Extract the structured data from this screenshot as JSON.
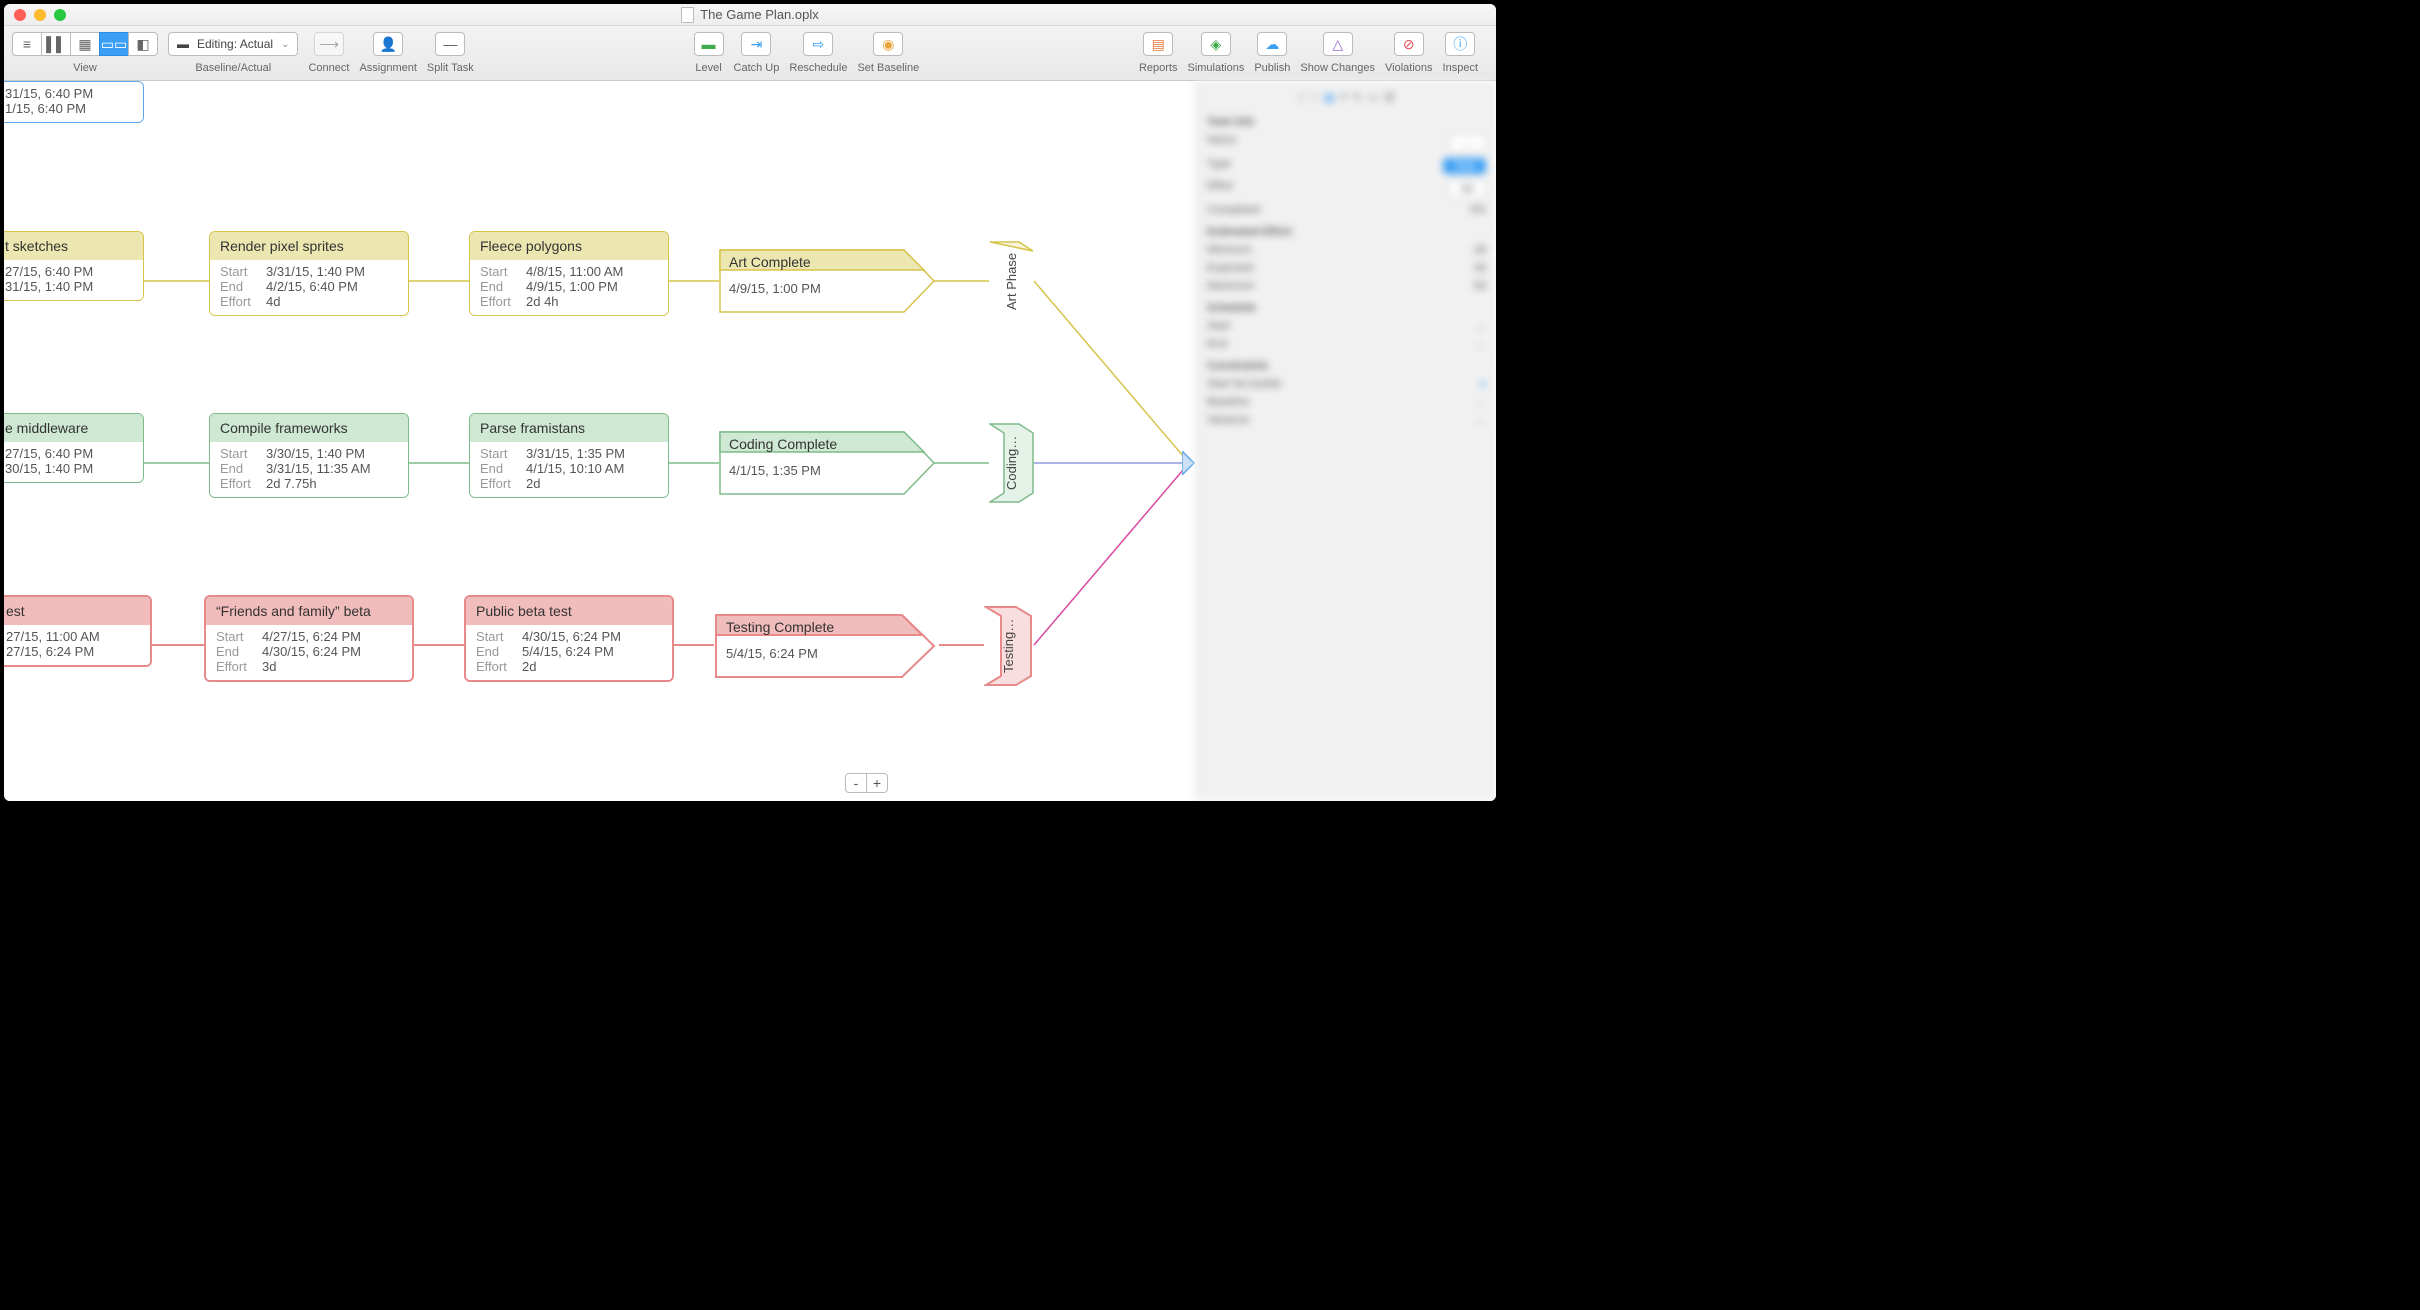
{
  "window": {
    "title": "The Game Plan.oplx"
  },
  "toolbar": {
    "view_label": "View",
    "baseline_label": "Baseline/Actual",
    "baseline_dropdown": "Editing: Actual",
    "connect": "Connect",
    "assignment": "Assignment",
    "split_task": "Split Task",
    "level": "Level",
    "catch_up": "Catch Up",
    "reschedule": "Reschedule",
    "set_baseline": "Set Baseline",
    "reports": "Reports",
    "simulations": "Simulations",
    "publish": "Publish",
    "show_changes": "Show Changes",
    "violations": "Violations",
    "inspect": "Inspect"
  },
  "partial_top": {
    "line1": "31/15, 6:40 PM",
    "line2": "1/15, 6:40 PM"
  },
  "tracks": {
    "art": {
      "cut0": {
        "title": "t sketches",
        "line1": "27/15, 6:40 PM",
        "line2": "31/15, 1:40 PM"
      },
      "n1": {
        "title": "Render pixel sprites",
        "start": "3/31/15, 1:40 PM",
        "end": "4/2/15, 6:40 PM",
        "effort": "4d"
      },
      "n2": {
        "title": "Fleece polygons",
        "start": "4/8/15, 11:00 AM",
        "end": "4/9/15, 1:00 PM",
        "effort": "2d 4h"
      },
      "milestone": {
        "title": "Art Complete",
        "date": "4/9/15, 1:00 PM"
      },
      "phase": "Art Phase"
    },
    "code": {
      "cut0": {
        "title": "e middleware",
        "line1": "27/15, 6:40 PM",
        "line2": "30/15, 1:40 PM"
      },
      "n1": {
        "title": "Compile frameworks",
        "start": "3/30/15, 1:40 PM",
        "end": "3/31/15, 11:35 AM",
        "effort": "2d 7.75h"
      },
      "n2": {
        "title": "Parse framistans",
        "start": "3/31/15, 1:35 PM",
        "end": "4/1/15, 10:10 AM",
        "effort": "2d"
      },
      "milestone": {
        "title": "Coding Complete",
        "date": "4/1/15, 1:35 PM"
      },
      "phase": "Coding…"
    },
    "test": {
      "cut0": {
        "title": "est",
        "line1": "27/15, 11:00 AM",
        "line2": "27/15, 6:24 PM"
      },
      "n1": {
        "title": "“Friends and family” beta",
        "start": "4/27/15, 6:24 PM",
        "end": "4/30/15, 6:24 PM",
        "effort": "3d"
      },
      "n2": {
        "title": "Public beta test",
        "start": "4/30/15, 6:24 PM",
        "end": "5/4/15, 6:24 PM",
        "effort": "2d"
      },
      "milestone": {
        "title": "Testing Complete",
        "date": "5/4/15, 6:24 PM"
      },
      "phase": "Testing…"
    }
  },
  "labels": {
    "start": "Start",
    "end": "End",
    "effort": "Effort"
  },
  "zoom": {
    "minus": "-",
    "plus": "+"
  }
}
